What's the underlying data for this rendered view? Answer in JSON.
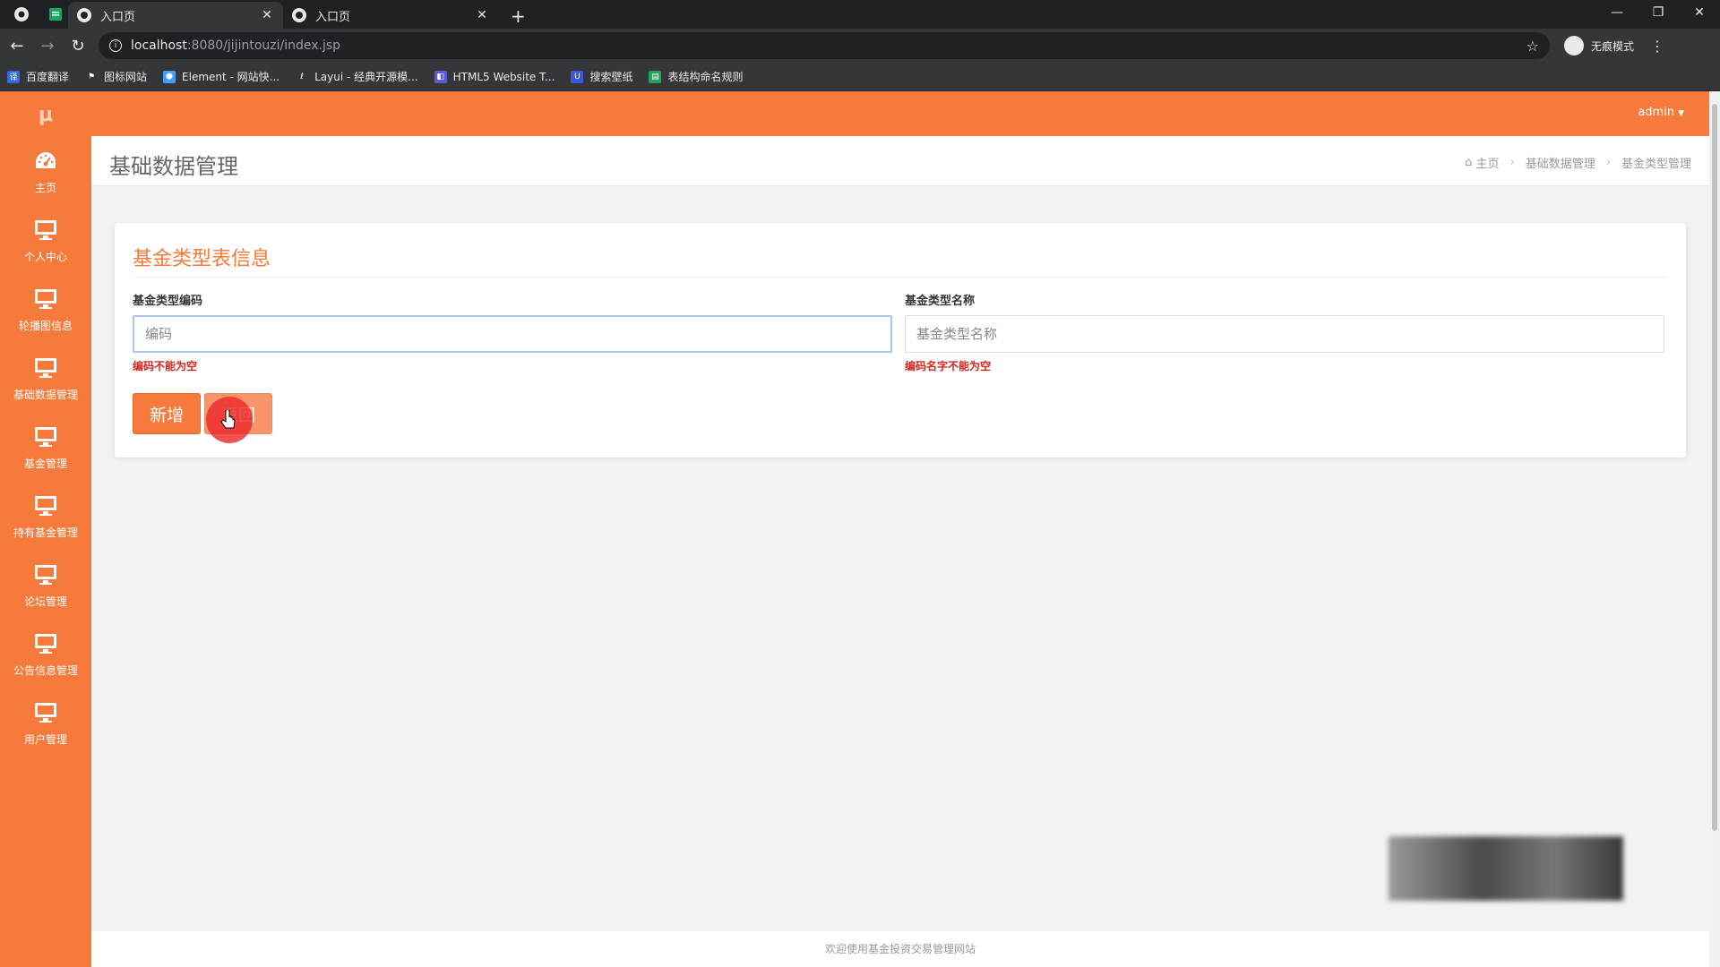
{
  "browser": {
    "tabs": [
      {
        "title": "入口页",
        "active": true
      },
      {
        "title": "入口页",
        "active": false
      }
    ],
    "url_host": "localhost",
    "url_path": ":8080/jijintouzi/index.jsp",
    "incognito_label": "无痕模式",
    "bookmarks": [
      {
        "label": "百度翻译",
        "icon": "translate-icon",
        "color": "#2d6cdf",
        "glyph": "译"
      },
      {
        "label": "图标网站",
        "icon": "flag-icon",
        "color": "#35363a",
        "glyph": "⚑"
      },
      {
        "label": "Element - 网站快...",
        "icon": "element-icon",
        "color": "#409eff",
        "glyph": "⬢"
      },
      {
        "label": "Layui - 经典开源模...",
        "icon": "layui-icon",
        "color": "#35363a",
        "glyph": "ℓ"
      },
      {
        "label": "HTML5 Website T...",
        "icon": "html5-icon",
        "color": "#5b5bd6",
        "glyph": "◧"
      },
      {
        "label": "搜索壁纸",
        "icon": "wallpaper-icon",
        "color": "#3a5bd9",
        "glyph": "U"
      },
      {
        "label": "表结构命名规则",
        "icon": "sheet-icon",
        "color": "#1ea362",
        "glyph": "▤"
      }
    ]
  },
  "header": {
    "user": "admin"
  },
  "sidebar": {
    "logo": "μ",
    "items": [
      {
        "label": "主页",
        "icon": "dashboard-icon"
      },
      {
        "label": "个人中心",
        "icon": "monitor-icon"
      },
      {
        "label": "轮播图信息",
        "icon": "monitor-icon"
      },
      {
        "label": "基础数据管理",
        "icon": "monitor-icon"
      },
      {
        "label": "基金管理",
        "icon": "monitor-icon"
      },
      {
        "label": "持有基金管理",
        "icon": "monitor-icon"
      },
      {
        "label": "论坛管理",
        "icon": "monitor-icon"
      },
      {
        "label": "公告信息管理",
        "icon": "monitor-icon"
      },
      {
        "label": "用户管理",
        "icon": "monitor-icon"
      }
    ]
  },
  "page": {
    "title": "基础数据管理",
    "breadcrumb": [
      "主页",
      "基础数据管理",
      "基金类型管理"
    ]
  },
  "form": {
    "heading": "基金类型表信息",
    "code_label": "基金类型编码",
    "code_placeholder": "编码",
    "code_value": "",
    "code_error": "编码不能为空",
    "name_label": "基金类型名称",
    "name_placeholder": "基金类型名称",
    "name_value": "",
    "name_error": "编码名字不能为空",
    "add_label": "新增",
    "back_label": "返回"
  },
  "footer": {
    "text": "欢迎使用基金投资交易管理网站"
  },
  "colors": {
    "accent": "#f57a3b",
    "error": "#d9241c"
  }
}
